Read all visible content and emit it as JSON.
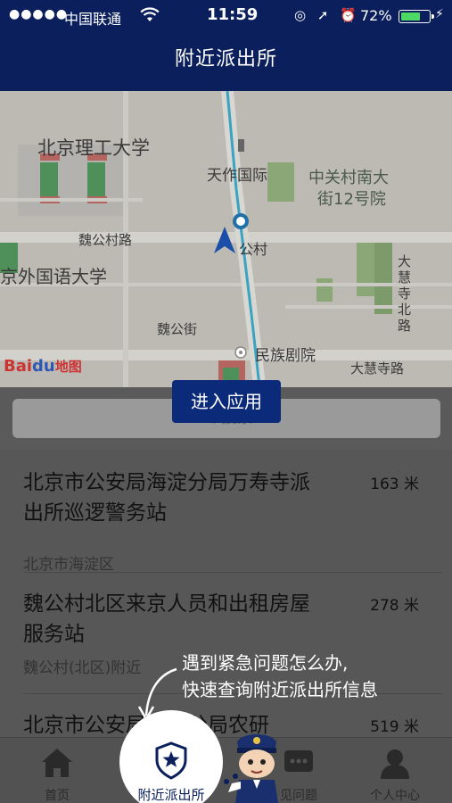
{
  "status_bar": {
    "signal": "●●●●●",
    "carrier": "中国联通",
    "wifi_icon": "wifi-icon",
    "time": "11:59",
    "icons": "◎ ➚ ⏰",
    "battery_percent": "72%",
    "battery_level": 0.72,
    "charging_icon": "⚡"
  },
  "header": {
    "title": "附近派出所"
  },
  "map": {
    "labels": {
      "bit": "北京理工大学",
      "tianzuo": "天作国际",
      "zhongguancun": "中关村南大",
      "zhongguancun2": "街12号院",
      "weigongcun_rd": "魏公村路",
      "weigongcun": "公村",
      "bfsu": "京外国语大学",
      "dahuisi_north": "大慧寺北路",
      "weigong_st": "魏公街",
      "minzu": "民族剧院",
      "dahuisi_rd": "大慧寺路"
    },
    "logo_text_1": "Bai",
    "logo_paw": "du",
    "logo_text_2": "地图",
    "accent": "#2d57b3"
  },
  "search": {
    "placeholder": "〈 搜索"
  },
  "enter_button": {
    "label": "进入应用"
  },
  "list": [
    {
      "title": "北京市公安局海淀分局万寿寺派出所巡逻警务站",
      "distance": "163 米",
      "address": "北京市海淀区"
    },
    {
      "title": "魏公村北区来京人员和出租房屋服务站",
      "distance": "278 米",
      "address": "魏公村(北区)附近"
    },
    {
      "title": "北京市公安局海淀分局农研",
      "distance": "519 米",
      "address": ""
    }
  ],
  "tabbar": {
    "home": "首页",
    "nearby": "附近派出所",
    "faq": "见问题",
    "me": "个人中心"
  },
  "callout": {
    "line1": "遇到紧急问题怎么办,",
    "line2": "快速查询附近派出所信息"
  },
  "colors": {
    "brand": "#0a1f5c",
    "button": "#0c2a7a"
  }
}
